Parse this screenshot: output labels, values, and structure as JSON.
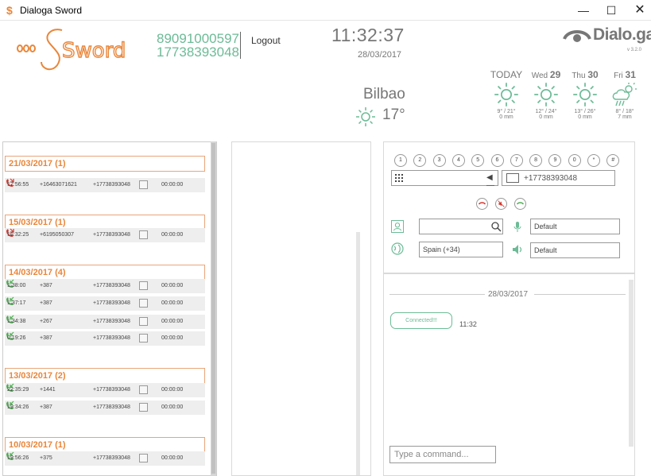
{
  "window": {
    "title": "Dialoga Sword",
    "app_icon": "$"
  },
  "header": {
    "logo_text": "Sword",
    "numbers": [
      "89091000597",
      "17738393048"
    ],
    "logout_label": "Logout",
    "clock": "11:32:37",
    "date": "28/03/2017",
    "brand": "Dialo.ga",
    "version": "v 3.2.0"
  },
  "weather": {
    "city": "Bilbao",
    "current_temp": "17°",
    "forecast": [
      {
        "day": "TODAY",
        "num": "",
        "icon": "sun-icon",
        "range": "9° / 21°",
        "rain": "0 mm"
      },
      {
        "day": "Wed",
        "num": "29",
        "icon": "sun-icon",
        "range": "12° / 24°",
        "rain": "0 mm"
      },
      {
        "day": "Thu",
        "num": "30",
        "icon": "sun-icon",
        "range": "13° / 26°",
        "rain": "0 mm"
      },
      {
        "day": "Fri",
        "num": "31",
        "icon": "rain-cloud-sun-icon",
        "range": "8° / 18°",
        "rain": "7 mm"
      }
    ]
  },
  "call_log": [
    {
      "date": "21/03/2017 (1)",
      "calls": [
        {
          "time": "17:56:55",
          "from": "+16463071621",
          "to": "+17738393048",
          "duration": "00:00:00",
          "status": "missed"
        }
      ]
    },
    {
      "date": "15/03/2017 (1)",
      "calls": [
        {
          "time": "16:32:25",
          "from": "+6195050307",
          "to": "+17738393048",
          "duration": "00:00:00",
          "status": "missed"
        }
      ]
    },
    {
      "date": "14/03/2017 (4)",
      "calls": [
        {
          "time": "1:38:00",
          "from": "+387",
          "to": "+17738393048",
          "duration": "00:00:00",
          "status": "answered"
        },
        {
          "time": "1:37:17",
          "from": "+387",
          "to": "+17738393048",
          "duration": "00:00:00",
          "status": "answered"
        },
        {
          "time": "1:34:38",
          "from": "+267",
          "to": "+17738393048",
          "duration": "00:00:00",
          "status": "answered"
        },
        {
          "time": "0:19:26",
          "from": "+387",
          "to": "+17738393048",
          "duration": "00:00:00",
          "status": "answered"
        }
      ]
    },
    {
      "date": "13/03/2017 (2)",
      "calls": [
        {
          "time": "22:35:29",
          "from": "+1441",
          "to": "+17738393048",
          "duration": "00:00:00",
          "status": "answered"
        },
        {
          "time": "19:34:26",
          "from": "+387",
          "to": "+17738393048",
          "duration": "00:00:00",
          "status": "answered"
        }
      ]
    },
    {
      "date": "10/03/2017 (1)",
      "calls": [
        {
          "time": "19:56:26",
          "from": "+375",
          "to": "+17738393048",
          "duration": "00:00:00",
          "status": "answered"
        }
      ]
    }
  ],
  "dialpad": {
    "keys": [
      "1",
      "2",
      "3",
      "4",
      "5",
      "6",
      "7",
      "8",
      "9",
      "0",
      "*",
      "#"
    ],
    "phone_number": "+17738393048",
    "search_value": "",
    "country_value": "Spain (+34)",
    "mic_device": "Default",
    "speaker_device": "Default"
  },
  "chat": {
    "date": "28/03/2017",
    "message": "Connected!!!",
    "message_time": "11:32",
    "command_placeholder": "Type a command..."
  },
  "colors": {
    "accent_orange": "#e9863a",
    "accent_green": "#6dbb97",
    "missed_red": "#d9342b",
    "answered_green": "#4caf50"
  }
}
